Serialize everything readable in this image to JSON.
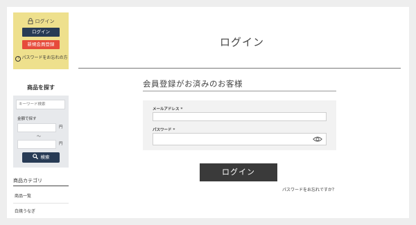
{
  "sidebar": {
    "login_box": {
      "heading": "ログイン",
      "login_button": "ログイン",
      "register_button": "新規会員登録",
      "forgot_link": "パスワードをお忘れの方"
    },
    "search": {
      "title": "商品を探す",
      "keyword_placeholder": "キーワード検索",
      "price_label": "金額で探す",
      "yen_min": "円",
      "range_sep": "〜",
      "yen_max": "円",
      "search_button": "検索"
    },
    "categories": {
      "title": "商品カテゴリ",
      "items": [
        "商品一覧",
        "白焼うなぎ"
      ]
    }
  },
  "main": {
    "title": "ログイン",
    "section_title": "会員登録がお済みのお客様",
    "email_label": "メールアドレス",
    "password_label": "パスワード",
    "required_mark": "*",
    "login_button": "ログイン",
    "forgot_link": "パスワードをお忘れですか？"
  },
  "colors": {
    "login_box_bg": "#eee08d",
    "navy_button": "#283b55",
    "register_button": "#e64b3b",
    "dark_button": "#3a3a3a"
  }
}
